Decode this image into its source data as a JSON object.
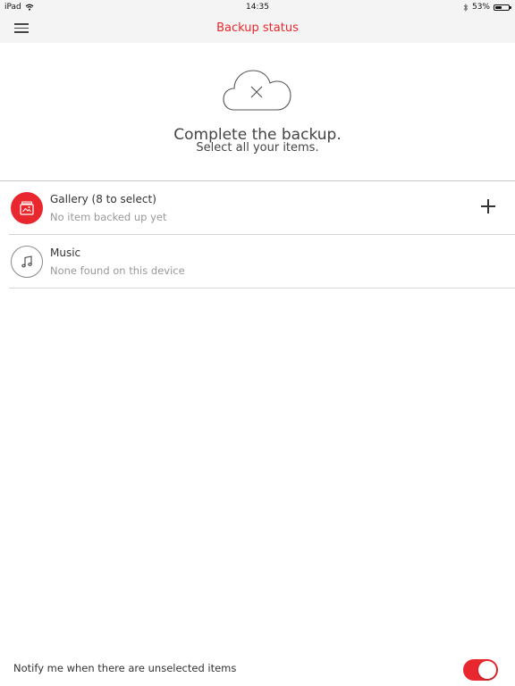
{
  "status_bar": {
    "device": "iPad",
    "time": "14:35",
    "battery_percent": "53%",
    "battery_level": 0.53,
    "icons": [
      "wifi-icon",
      "bluetooth-icon",
      "battery-icon"
    ]
  },
  "navbar": {
    "title": "Backup status",
    "menu_icon": "hamburger-menu-icon"
  },
  "hero": {
    "icon": "cloud-x-icon",
    "title": "Complete the backup.",
    "subtitle": "Select all your items."
  },
  "items": [
    {
      "icon": "gallery-icon",
      "title": "Gallery (8 to select)",
      "subtitle": "No item backed up yet",
      "action_icon": "plus-icon"
    },
    {
      "icon": "music-note-icon",
      "title": "Music",
      "subtitle": "None found on this device"
    }
  ],
  "footer": {
    "notify_label": "Notify me when there are unselected items",
    "notify_enabled": true
  },
  "colors": {
    "accent": "#e8282e",
    "bar_background": "#f4f4f4",
    "secondary_text": "#999999"
  }
}
